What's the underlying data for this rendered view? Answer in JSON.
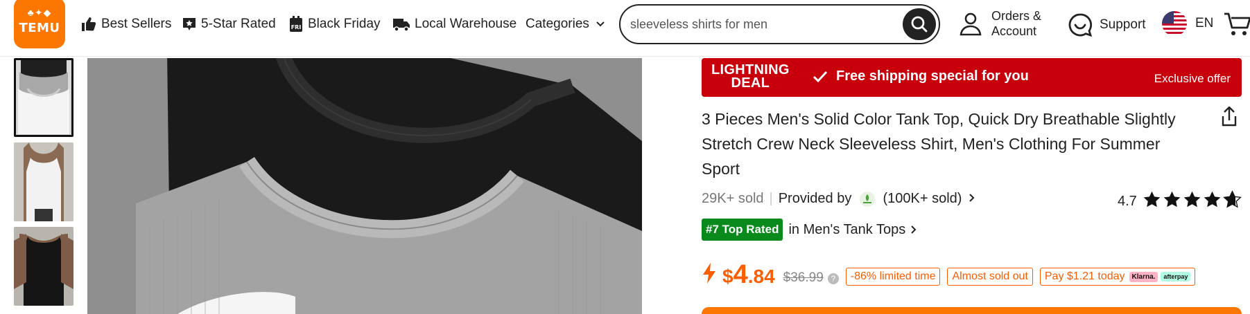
{
  "header": {
    "logo_text": "TEMU",
    "nav": [
      {
        "label": "Best Sellers",
        "icon": "thumbs-up-icon"
      },
      {
        "label": "5-Star Rated",
        "icon": "star-badge-icon"
      },
      {
        "label": "Black Friday",
        "icon": "black-friday-icon"
      },
      {
        "label": "Local Warehouse",
        "icon": "truck-icon"
      },
      {
        "label": "Categories",
        "icon": "chevron-down-icon"
      }
    ],
    "search": {
      "value": "sleeveless shirts for men",
      "placeholder": ""
    },
    "account_line1": "Orders &",
    "account_line2": "Account",
    "support": "Support",
    "language": "EN"
  },
  "banner": {
    "line1": "LIGHTNING",
    "line2": "DEAL",
    "shipping": "Free shipping special for you",
    "exclusive": "Exclusive offer"
  },
  "product": {
    "title": "3 Pieces Men's Solid Color Tank Top, Quick Dry Breathable Slightly Stretch Crew Neck Sleeveless Shirt, Men's Clothing For Summer Sport",
    "sold": "29K+ sold",
    "provided_by": "Provided by",
    "seller_sold": "(100K+ sold)",
    "rating": "4.7",
    "rating_value": 4.7,
    "top_rated_badge": "#7 Top Rated",
    "top_rated_category": "in Men's Tank Tops",
    "price_currency": "$",
    "price_int": "4",
    "price_dec": ".84",
    "original_price": "$36.99",
    "discount_tag": "-86% limited time",
    "stock_tag": "Almost sold out",
    "pay_tag": "Pay $1.21 today",
    "klarna": "Klarna.",
    "afterpay": "afterpay"
  },
  "colors": {
    "brand": "#fb7701",
    "banner": "#c8000c",
    "price": "#fb5d01",
    "badge": "#0a8a1c"
  }
}
